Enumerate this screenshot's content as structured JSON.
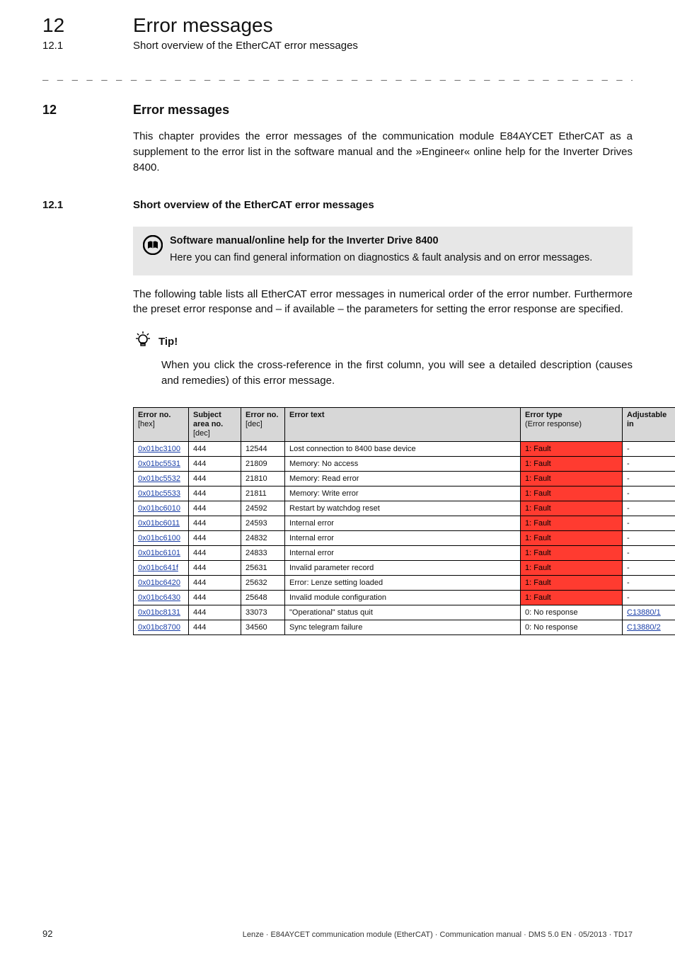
{
  "header": {
    "chapter_no": "12",
    "chapter_title": "Error messages",
    "section_no": "12.1",
    "section_title": "Short overview of the EtherCAT error messages"
  },
  "dashes": "_ _ _ _ _ _ _ _ _ _ _ _ _ _ _ _ _ _ _ _ _ _ _ _ _ _ _ _ _ _ _ _ _ _ _ _ _ _ _ _ _ _ _ _ _ _ _ _ _ _ _ _ _ _ _ _ _ _ _ _ _ _ _ _",
  "section_heading": {
    "num": "12",
    "title": "Error messages"
  },
  "intro_paragraph": "This chapter provides the error messages of the communication module E84AYCET EtherCAT as a supplement to the error list in the software manual and the »Engineer« online help for the Inverter Drives 8400.",
  "subsection_heading": {
    "num": "12.1",
    "title": "Short overview of the EtherCAT error messages"
  },
  "callout": {
    "heading": "Software manual/online help for the Inverter Drive 8400",
    "text": "Here you can find general information on diagnostics & fault analysis and on error messages."
  },
  "paragraph2": "The following table lists all EtherCAT error messages in numerical order of the error number. Furthermore the preset error response and – if available – the parameters for setting the error response are specified.",
  "tip": {
    "label": "Tip!",
    "text": "When you click the cross-reference in the first column, you will see a detailed description (causes and remedies) of this error message."
  },
  "table": {
    "columns": [
      {
        "line1": "Error no.",
        "line2": "[hex]"
      },
      {
        "line1": "Subject area no.",
        "line2": "[dec]"
      },
      {
        "line1": "Error no.",
        "line2": "[dec]"
      },
      {
        "line1": "Error text",
        "line2": ""
      },
      {
        "line1": "Error type",
        "line2": "(Error response)"
      },
      {
        "line1": "Adjustable in",
        "line2": ""
      }
    ],
    "rows": [
      {
        "hex": "0x01bc3100",
        "subj": "444",
        "dec": "12544",
        "text": "Lost connection to 8400 base device",
        "type": "1: Fault",
        "fault": true,
        "adj": "-",
        "adj_link": false
      },
      {
        "hex": "0x01bc5531",
        "subj": "444",
        "dec": "21809",
        "text": "Memory: No access",
        "type": "1: Fault",
        "fault": true,
        "adj": "-",
        "adj_link": false
      },
      {
        "hex": "0x01bc5532",
        "subj": "444",
        "dec": "21810",
        "text": "Memory: Read error",
        "type": "1: Fault",
        "fault": true,
        "adj": "-",
        "adj_link": false
      },
      {
        "hex": "0x01bc5533",
        "subj": "444",
        "dec": "21811",
        "text": "Memory: Write error",
        "type": "1: Fault",
        "fault": true,
        "adj": "-",
        "adj_link": false
      },
      {
        "hex": "0x01bc6010",
        "subj": "444",
        "dec": "24592",
        "text": "Restart by watchdog reset",
        "type": "1: Fault",
        "fault": true,
        "adj": "-",
        "adj_link": false
      },
      {
        "hex": "0x01bc6011",
        "subj": "444",
        "dec": "24593",
        "text": "Internal error",
        "type": "1: Fault",
        "fault": true,
        "adj": "-",
        "adj_link": false
      },
      {
        "hex": "0x01bc6100",
        "subj": "444",
        "dec": "24832",
        "text": "Internal error",
        "type": "1: Fault",
        "fault": true,
        "adj": "-",
        "adj_link": false
      },
      {
        "hex": "0x01bc6101",
        "subj": "444",
        "dec": "24833",
        "text": "Internal error",
        "type": "1: Fault",
        "fault": true,
        "adj": "-",
        "adj_link": false
      },
      {
        "hex": "0x01bc641f",
        "subj": "444",
        "dec": "25631",
        "text": "Invalid parameter record",
        "type": "1: Fault",
        "fault": true,
        "adj": "-",
        "adj_link": false
      },
      {
        "hex": "0x01bc6420",
        "subj": "444",
        "dec": "25632",
        "text": "Error: Lenze setting loaded",
        "type": "1: Fault",
        "fault": true,
        "adj": "-",
        "adj_link": false
      },
      {
        "hex": "0x01bc6430",
        "subj": "444",
        "dec": "25648",
        "text": "Invalid module configuration",
        "type": "1: Fault",
        "fault": true,
        "adj": "-",
        "adj_link": false
      },
      {
        "hex": "0x01bc8131",
        "subj": "444",
        "dec": "33073",
        "text": "\"Operational\" status quit",
        "type": "0: No response",
        "fault": false,
        "adj": "C13880/1",
        "adj_link": true
      },
      {
        "hex": "0x01bc8700",
        "subj": "444",
        "dec": "34560",
        "text": "Sync telegram failure",
        "type": "0: No response",
        "fault": false,
        "adj": "C13880/2",
        "adj_link": true
      }
    ]
  },
  "footer": {
    "page": "92",
    "text": "Lenze · E84AYCET communication module (EtherCAT) · Communication manual · DMS 5.0 EN · 05/2013 · TD17"
  }
}
